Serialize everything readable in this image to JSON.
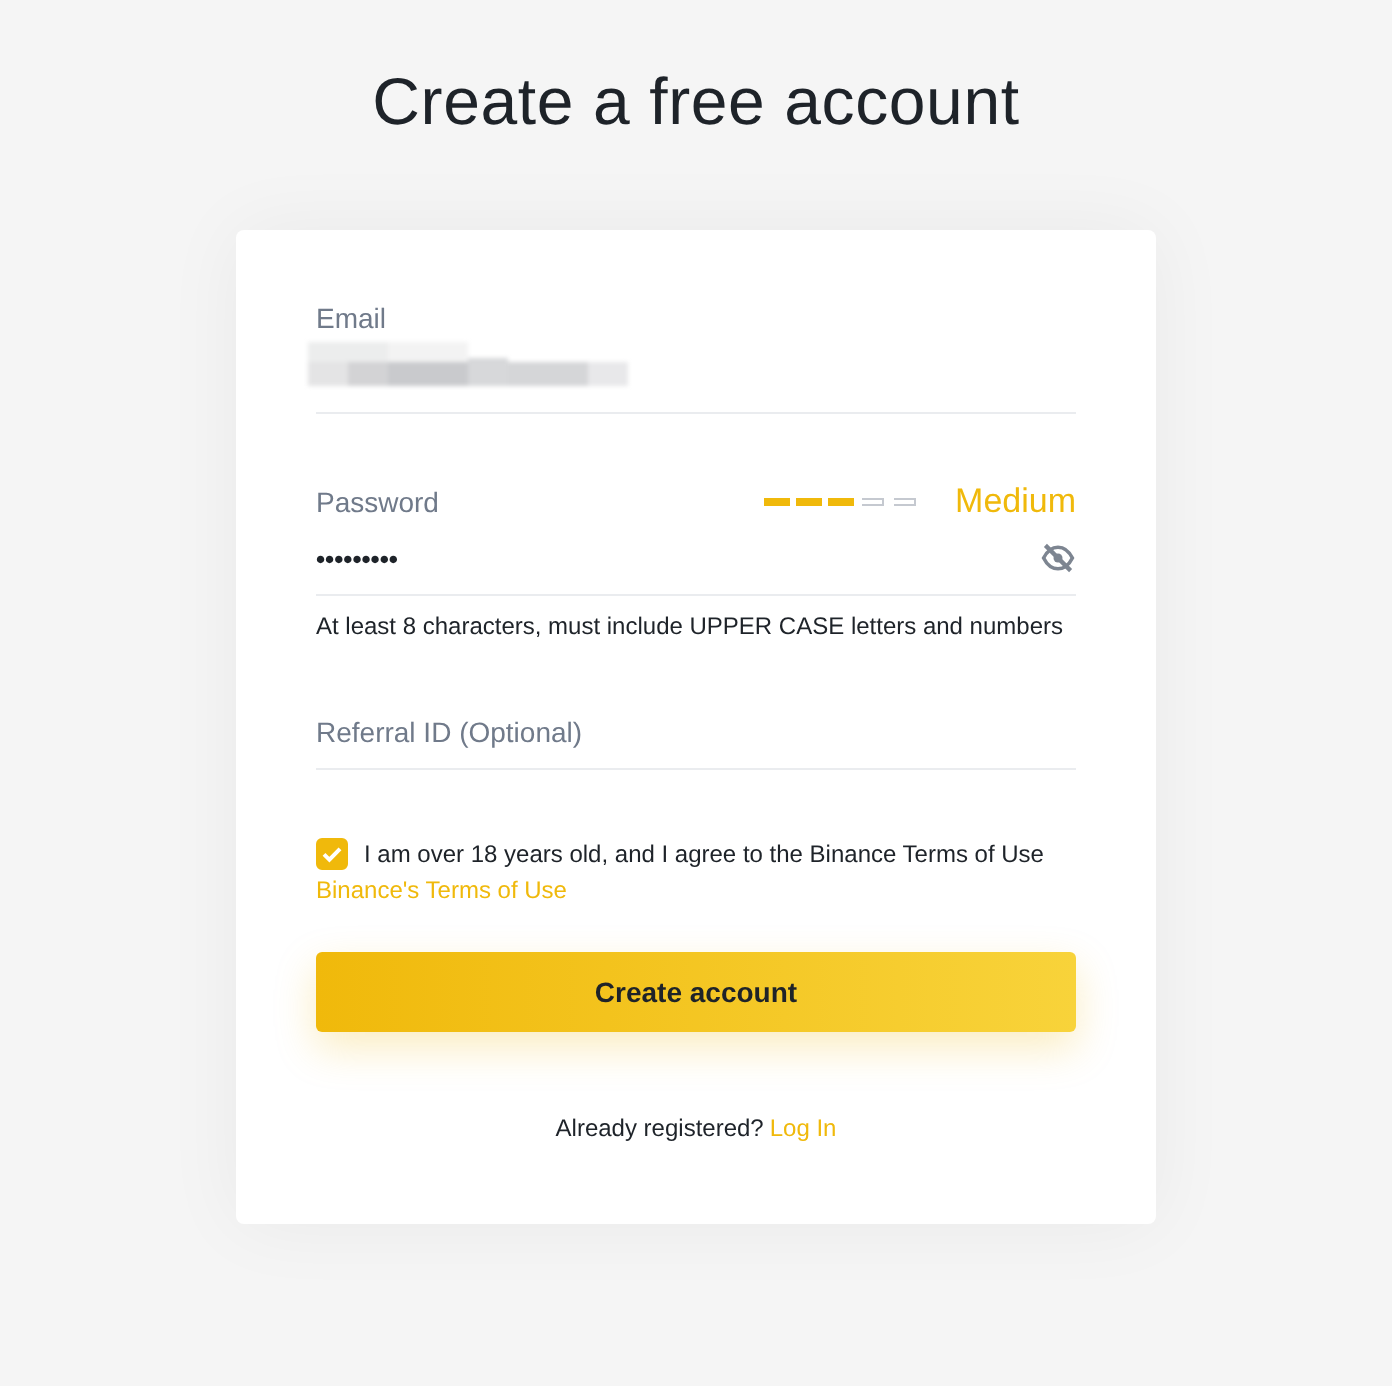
{
  "title": "Create a free account",
  "email": {
    "label": "Email",
    "value_blurred": true
  },
  "password": {
    "label": "Password",
    "value": "•••••••••",
    "strength": {
      "level": 0.6,
      "label": "Medium"
    },
    "visible": false,
    "hint": "At least 8 characters, must include UPPER CASE letters and numbers"
  },
  "referral": {
    "placeholder": "Referral ID (Optional)"
  },
  "agreement": {
    "checked": true,
    "text": "I am over 18 years old, and I agree to the Binance Terms of Use",
    "link": "Binance's Terms of Use"
  },
  "submit": {
    "label": "Create account"
  },
  "footer": {
    "text": "Already registered?",
    "link": "Log In"
  }
}
